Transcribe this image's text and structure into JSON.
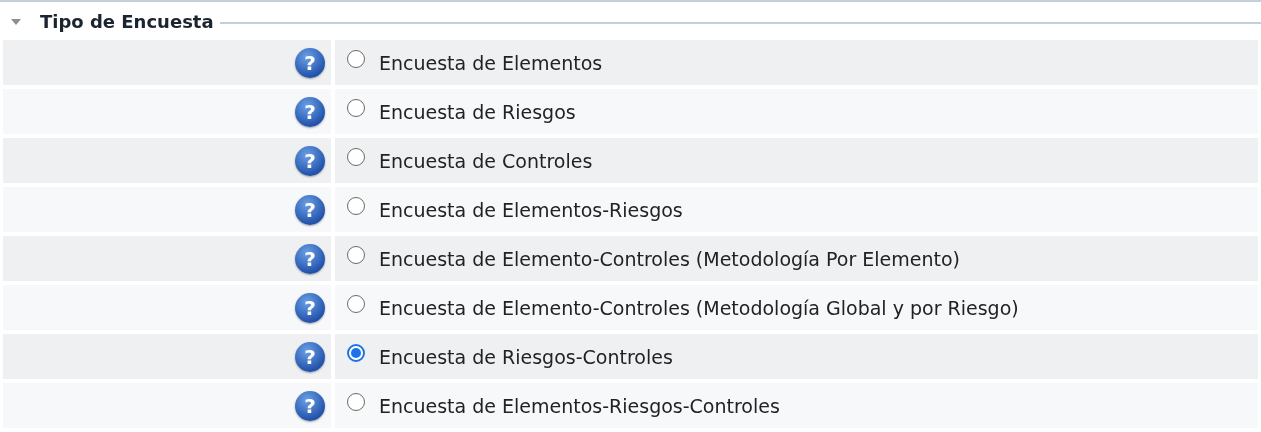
{
  "section": {
    "title": "Tipo de Encuesta",
    "expanded": true
  },
  "options": [
    {
      "label": "Encuesta de Elementos",
      "help": "?",
      "selected": false
    },
    {
      "label": "Encuesta de Riesgos",
      "help": "?",
      "selected": false
    },
    {
      "label": "Encuesta de Controles",
      "help": "?",
      "selected": false
    },
    {
      "label": "Encuesta de Elementos-Riesgos",
      "help": "?",
      "selected": false
    },
    {
      "label": "Encuesta de Elemento-Controles (Metodología Por Elemento)",
      "help": "?",
      "selected": false
    },
    {
      "label": "Encuesta de Elemento-Controles (Metodología Global y por Riesgo)",
      "help": "?",
      "selected": false
    },
    {
      "label": "Encuesta de Riesgos-Controles",
      "help": "?",
      "selected": true
    },
    {
      "label": "Encuesta de Elementos-Riesgos-Controles",
      "help": "?",
      "selected": false
    }
  ]
}
